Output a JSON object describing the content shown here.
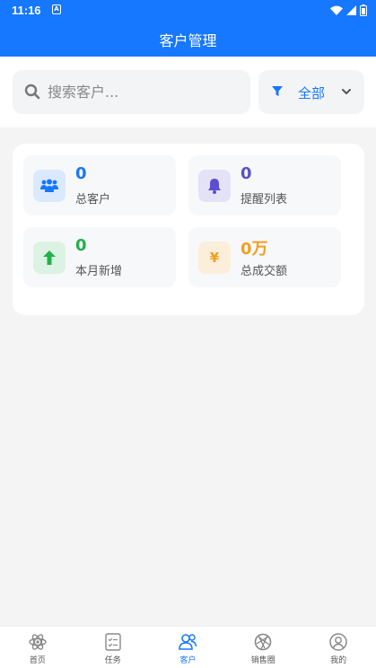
{
  "status_bar": {
    "time": "11:16",
    "notification": "A"
  },
  "header": {
    "title": "客户管理"
  },
  "search": {
    "placeholder": "搜索客户..."
  },
  "filter": {
    "label": "全部"
  },
  "stats": [
    {
      "value": "0",
      "label": "总客户",
      "color": "#1677ff",
      "icon_bg": "#dbe9ff",
      "icon": "users-icon"
    },
    {
      "value": "0",
      "label": "提醒列表",
      "color": "#5b4fcf",
      "icon_bg": "#e4e2f7",
      "icon": "bell-icon"
    },
    {
      "value": "0",
      "label": "本月新增",
      "color": "#22b14c",
      "icon_bg": "#dcf3e3",
      "icon": "arrow-up-icon"
    },
    {
      "value": "0万",
      "label": "总成交额",
      "color": "#f0a020",
      "icon_bg": "#fbeedb",
      "icon": "yen-icon"
    }
  ],
  "nav": [
    {
      "label": "首页",
      "icon": "home-icon",
      "active": false
    },
    {
      "label": "任务",
      "icon": "task-icon",
      "active": false
    },
    {
      "label": "客户",
      "icon": "customer-icon",
      "active": true
    },
    {
      "label": "销售圈",
      "icon": "aperture-icon",
      "active": false
    },
    {
      "label": "我的",
      "icon": "profile-icon",
      "active": false
    }
  ],
  "colors": {
    "primary": "#1677ff",
    "background": "#f4f4f5"
  }
}
